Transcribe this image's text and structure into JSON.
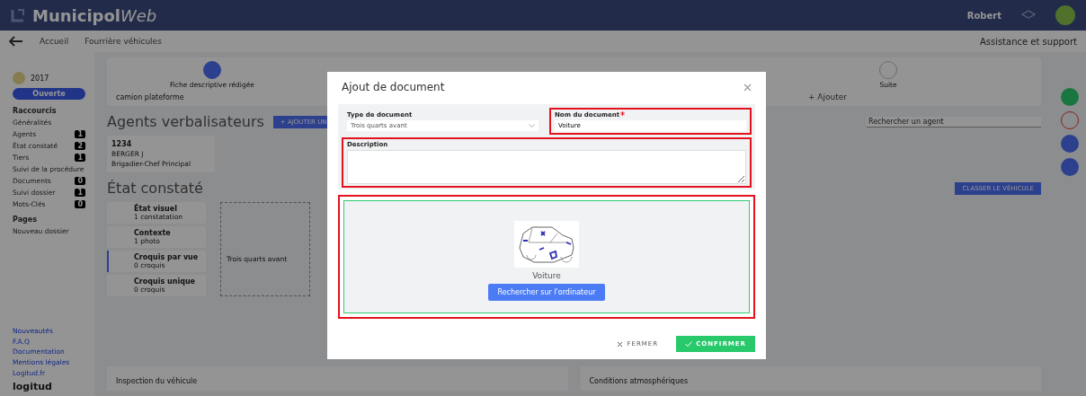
{
  "topbar": {
    "logo_main": "Municipol",
    "logo_accent": "Web",
    "user": "Robert"
  },
  "breadcrumb": {
    "items": [
      "Accueil",
      "Fourrière véhicules"
    ],
    "help": "Assistance et support"
  },
  "sidebar": {
    "year": "2017",
    "status": "Ouverte",
    "shortcuts_title": "Raccourcis",
    "items": [
      {
        "label": "Généralités"
      },
      {
        "label": "Agents",
        "count": "1"
      },
      {
        "label": "État constaté",
        "count": "2"
      },
      {
        "label": "Tiers",
        "count": "1"
      },
      {
        "label": "Suivi de la procédure"
      },
      {
        "label": "Documents",
        "count": "0"
      },
      {
        "label": "Suivi dossier",
        "count": "1"
      },
      {
        "label": "Mots-Clés",
        "count": "0"
      }
    ],
    "pages": "Pages",
    "new_folder": "Nouveau dossier",
    "links": [
      "Nouveautés",
      "F.A.Q",
      "Documentation",
      "Mentions légales",
      "Logitud.fr"
    ],
    "brand": "logitud"
  },
  "timeline": {
    "steps": [
      {
        "label": "Fiche descriptive rédigée",
        "done": true
      },
      {
        "label": "Suite",
        "done": false
      }
    ],
    "vehicle": "camion plateforme",
    "add": "+ Ajouter"
  },
  "agents": {
    "title": "Agents verbalisateurs",
    "add_button": "+ AJOUTER UN",
    "search_placeholder": "Rechercher un agent",
    "cards": [
      {
        "number": "1234",
        "name": "BERGER J",
        "rank": "Brigadier-Chef Principal"
      }
    ]
  },
  "state": {
    "title": "État constaté",
    "classify_button": "CLASSER LE VÉHICULE",
    "items": [
      {
        "title": "État visuel",
        "detail": "1 constatation",
        "selected": false
      },
      {
        "title": "Contexte",
        "detail": "1 photo",
        "selected": false
      },
      {
        "title": "Croquis par vue",
        "detail": "0 croquis",
        "selected": true
      },
      {
        "title": "Croquis unique",
        "detail": "0 croquis",
        "selected": false
      }
    ],
    "view_card": {
      "title": "Trois quarts avant"
    }
  },
  "bottom_cards": [
    "Inspection du véhicule",
    "Conditions atmosphériques"
  ],
  "modal": {
    "title": "Ajout de document",
    "type_field": {
      "label": "Type de document",
      "value": "Trois quarts avant",
      "highlighted": false
    },
    "name_field": {
      "label": "Nom du document",
      "required": true,
      "value": "Voiture",
      "highlighted": true
    },
    "description_field": {
      "label": "Description",
      "highlighted": true
    },
    "dropzone": {
      "caption": "Voiture",
      "button": "Rechercher sur l'ordinateur",
      "highlighted": true
    },
    "close_button": "FERMER",
    "confirm_button": "CONFIRMER"
  }
}
